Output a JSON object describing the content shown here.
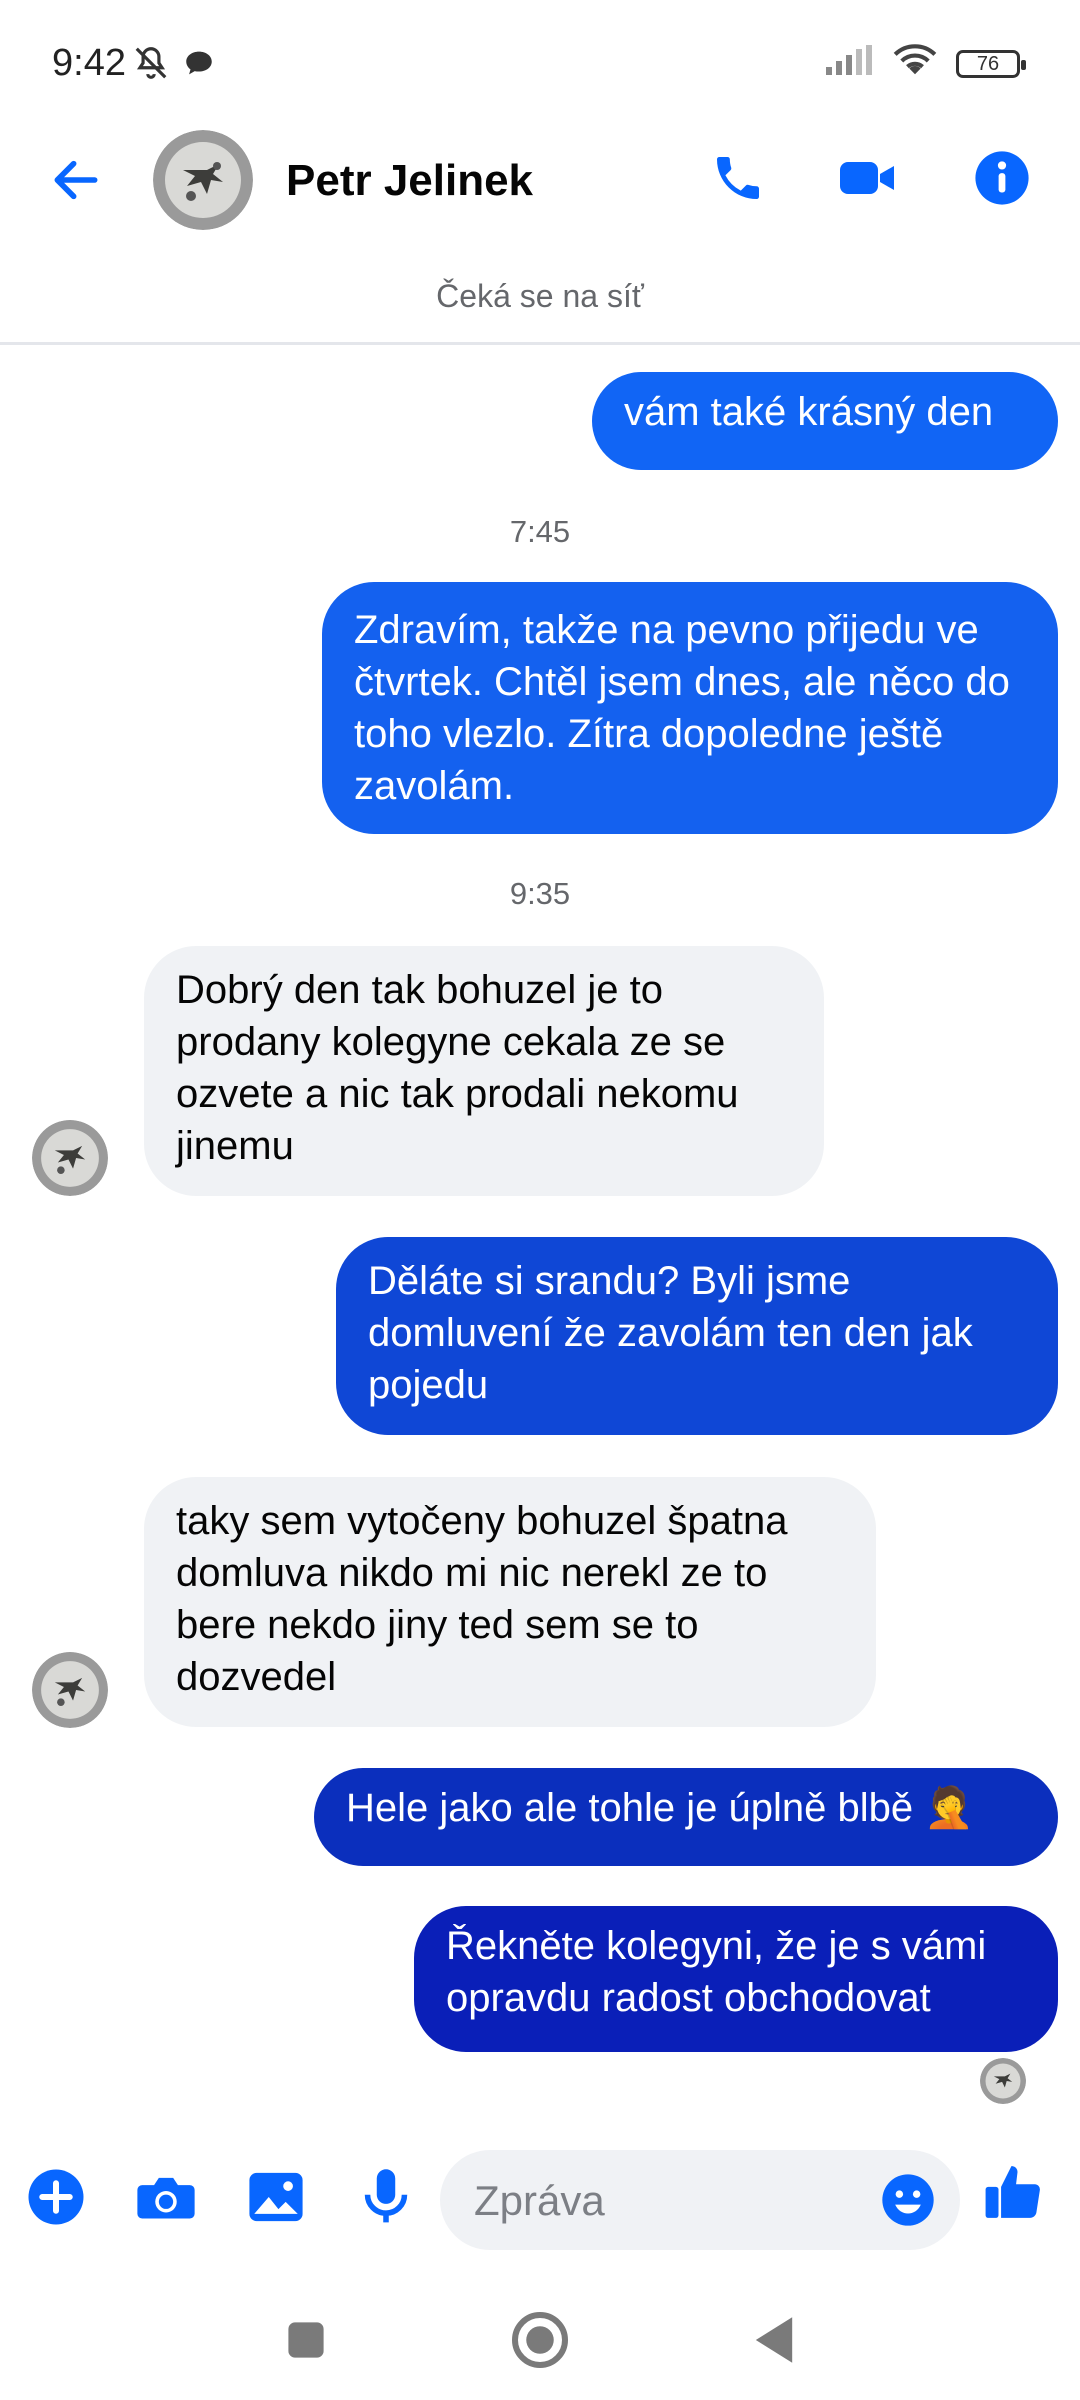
{
  "status_bar": {
    "time": "9:42",
    "battery": "76",
    "left_icons": [
      "mute-bell-icon",
      "chat-bubble-icon"
    ],
    "right_icons": [
      "signal-icon",
      "wifi-icon",
      "battery-icon"
    ]
  },
  "header": {
    "contact_name": "Petr Jelinek",
    "network_status": "Čeká se na síť",
    "icons": [
      "back-arrow-icon",
      "phone-icon",
      "video-camera-icon",
      "info-icon"
    ]
  },
  "messages": [
    {
      "id": "m1",
      "direction": "out",
      "text": "vám také krásný den",
      "color": "#1165f5"
    },
    {
      "id": "t1",
      "type": "timestamp",
      "text": "7:45"
    },
    {
      "id": "m2",
      "direction": "out",
      "text": "Zdravím, takže na pevno přijedu ve čtvrtek. Chtěl jsem dnes, ale něco do toho vlezlo. Zítra dopoledne ještě zavolám.",
      "color": "#1461ef"
    },
    {
      "id": "t2",
      "type": "timestamp",
      "text": "9:35"
    },
    {
      "id": "m3",
      "direction": "in",
      "text": "Dobrý den tak bohuzel je to prodany kolegyne cekala ze se ozvete a nic tak prodali nekomu jinemu"
    },
    {
      "id": "m4",
      "direction": "out",
      "text": "Děláte si srandu? Byli jsme domluvení že zavolám ten den jak pojedu",
      "color": "#0f47d6"
    },
    {
      "id": "m5",
      "direction": "in",
      "text": "taky sem vytočeny bohuzel špatna domluva nikdo mi nic nerekl ze to bere nekdo jiny ted sem se to dozvedel"
    },
    {
      "id": "m6",
      "direction": "out",
      "text": "Hele jako ale tohle je úplně blbě 🤦",
      "color": "#0b2fbd"
    },
    {
      "id": "m7",
      "direction": "out",
      "text": "Řekněte kolegyni, že je s vámi opravdu radost obchodovat",
      "color": "#0a1fb8"
    }
  ],
  "composer": {
    "placeholder": "Zpráva",
    "icons": [
      "plus-icon",
      "camera-icon",
      "gallery-icon",
      "microphone-icon",
      "emoji-icon",
      "thumbs-up-icon"
    ]
  },
  "nav_bar": {
    "icons": [
      "recents-square-icon",
      "home-circle-icon",
      "back-triangle-icon"
    ]
  },
  "colors": {
    "accent": "#0866ff",
    "incoming_bubble": "#f0f2f5",
    "secondary_text": "#65676b"
  }
}
